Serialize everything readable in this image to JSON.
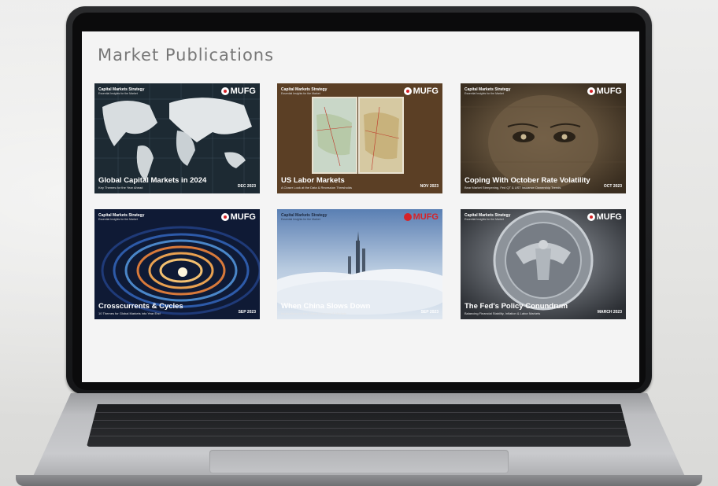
{
  "page": {
    "title": "Market Publications"
  },
  "brand": {
    "logo_text": "MUFG",
    "accent": "#d62328"
  },
  "publications": [
    {
      "series": "Capital Markets Strategy",
      "tagline": "Essential Insights for the Market",
      "title": "Global Capital Markets in 2024",
      "subtitle": "Key Themes for the Year Ahead",
      "date": "DEC 2023",
      "theme": "world-map"
    },
    {
      "series": "Capital Markets Strategy",
      "tagline": "Essential Insights for the Market",
      "title": "US Labor Markets",
      "subtitle": "A Closer Look at the Data & Recession Thresholds",
      "date": "NOV 2023",
      "theme": "road-map"
    },
    {
      "series": "Capital Markets Strategy",
      "tagline": "Essential Insights for the Market",
      "title": "Coping With October Rate Volatility",
      "subtitle": "Bear Market Steepening, Fed QT & UST Issuance Ownership Trends",
      "date": "OCT 2023",
      "theme": "hundred-dollar"
    },
    {
      "series": "Capital Markets Strategy",
      "tagline": "Essential Insights for the Market",
      "title": "Crosscurrents & Cycles",
      "subtitle": "10 Themes for Global Markets into Year End",
      "date": "SEP 2023",
      "theme": "abstract-swirl"
    },
    {
      "series": "Capital Markets Strategy",
      "tagline": "Essential Insights for the Market",
      "title": "When China Slows Down",
      "subtitle": "Implications for the Global Economy & Markets",
      "date": "SEP 2023",
      "theme": "skyline-clouds"
    },
    {
      "series": "Capital Markets Strategy",
      "tagline": "Essential Insights for the Market",
      "title": "The Fed's Policy Conundrum",
      "subtitle": "Balancing Financial Stability, Inflation & Labor Markets",
      "date": "MARCH 2023",
      "theme": "fed-seal"
    }
  ]
}
